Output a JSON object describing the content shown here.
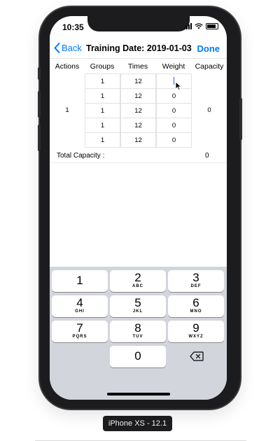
{
  "status": {
    "time": "10:35"
  },
  "nav": {
    "back_label": "Back",
    "title": "Training Date: 2019-01-03",
    "done_label": "Done"
  },
  "table": {
    "headers": [
      "Actions",
      "Groups",
      "Times",
      "Weight",
      "Capacity"
    ],
    "action_value": "1",
    "capacity_value": "0",
    "rows": [
      {
        "groups": "1",
        "times": "12",
        "weight": ""
      },
      {
        "groups": "1",
        "times": "12",
        "weight": "0"
      },
      {
        "groups": "1",
        "times": "12",
        "weight": "0"
      },
      {
        "groups": "1",
        "times": "12",
        "weight": "0"
      },
      {
        "groups": "1",
        "times": "12",
        "weight": "0"
      }
    ]
  },
  "total": {
    "label": "Total Capacity :",
    "value": "0"
  },
  "keyboard": {
    "keys": [
      {
        "num": "1",
        "letters": ""
      },
      {
        "num": "2",
        "letters": "ABC"
      },
      {
        "num": "3",
        "letters": "DEF"
      },
      {
        "num": "4",
        "letters": "GHI"
      },
      {
        "num": "5",
        "letters": "JKL"
      },
      {
        "num": "6",
        "letters": "MNO"
      },
      {
        "num": "7",
        "letters": "PQRS"
      },
      {
        "num": "8",
        "letters": "TUV"
      },
      {
        "num": "9",
        "letters": "WXYZ"
      },
      {
        "num": "0",
        "letters": ""
      }
    ]
  },
  "device_label": "iPhone XS - 12.1",
  "colors": {
    "accent": "#007aff",
    "keyboard_bg": "#d2d5db"
  },
  "icons": [
    "back-chevron-icon",
    "wifi-icon",
    "battery-icon",
    "signal-icon",
    "backspace-icon",
    "pointer-cursor-icon"
  ]
}
